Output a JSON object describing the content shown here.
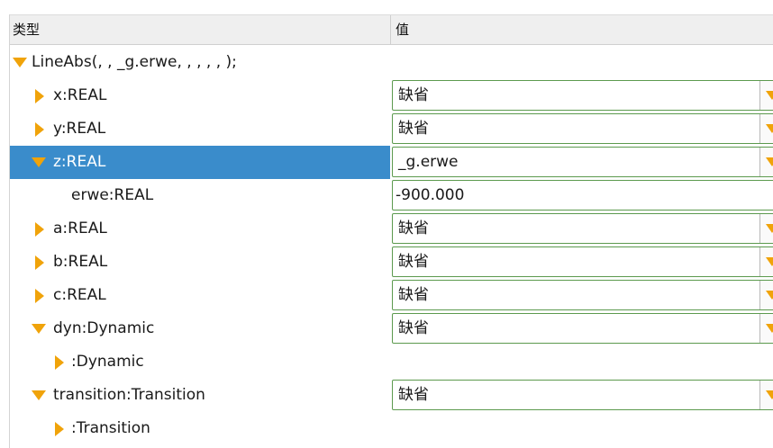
{
  "header": {
    "col_type": "类型",
    "col_value": "值"
  },
  "rows": [
    {
      "label": "LineAbs(, , _g.erwe, , , , , );"
    },
    {
      "label": "x:REAL",
      "value": "缺省"
    },
    {
      "label": "y:REAL",
      "value": "缺省"
    },
    {
      "label": "z:REAL",
      "value": "_g.erwe"
    },
    {
      "label": "erwe:REAL",
      "value": "-900.000"
    },
    {
      "label": "a:REAL",
      "value": "缺省"
    },
    {
      "label": "b:REAL",
      "value": "缺省"
    },
    {
      "label": "c:REAL",
      "value": "缺省"
    },
    {
      "label": "dyn:Dynamic",
      "value": "缺省"
    },
    {
      "label": ":Dynamic"
    },
    {
      "label": "transition:Transition",
      "value": "缺省"
    },
    {
      "label": ":Transition"
    }
  ],
  "colors": {
    "accent_triangle": "#f0a30a",
    "selection": "#3a8ccb",
    "field_border": "#5c9a4e"
  }
}
